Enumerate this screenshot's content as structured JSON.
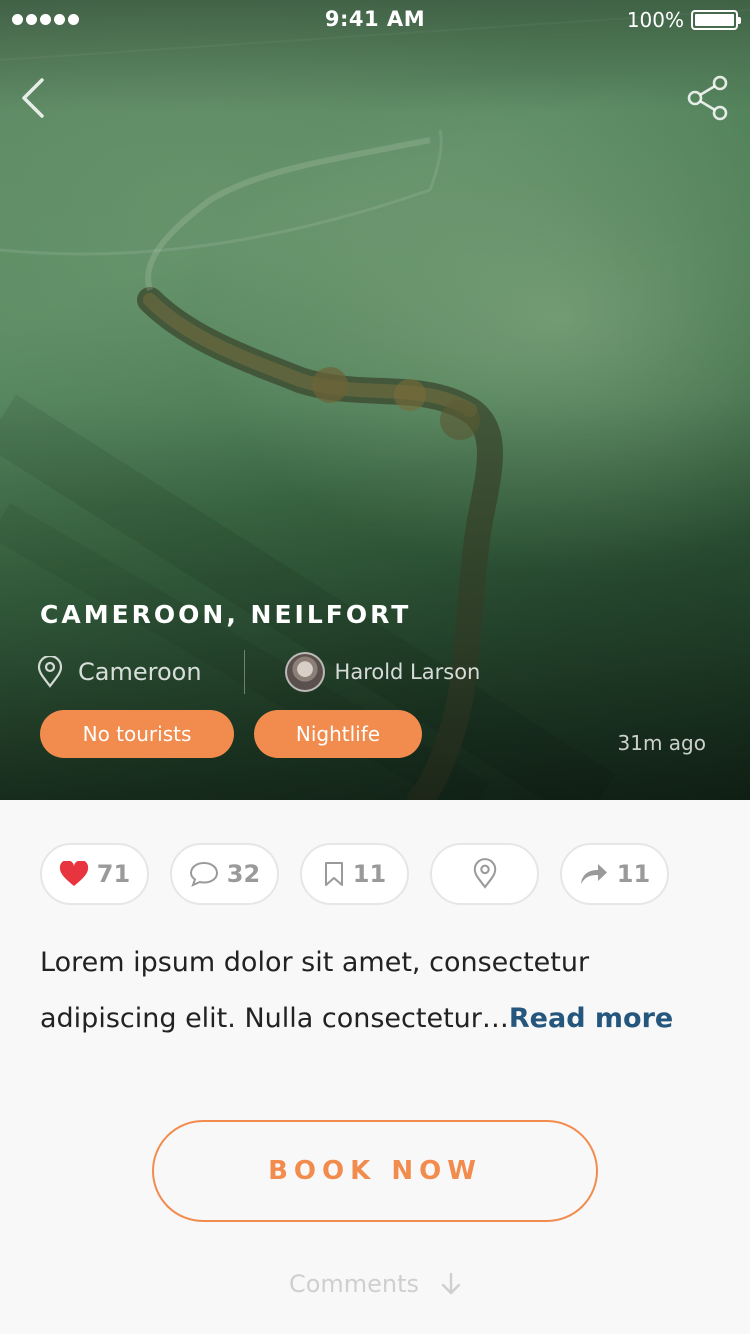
{
  "status_bar": {
    "time": "9:41 AM",
    "battery": "100%"
  },
  "hero": {
    "title": "CAMEROON, NEILFORT",
    "location": "Cameroon",
    "author": "Harold Larson",
    "tags": [
      "No tourists",
      "Nightlife"
    ],
    "time_ago": "31m ago"
  },
  "stats": {
    "likes": "71",
    "comments": "32",
    "bookmarks": "11",
    "shares": "11"
  },
  "description": {
    "text": "Lorem ipsum dolor sit amet, consectetur adipiscing elit. Nulla consectetur…",
    "read_more": "Read more"
  },
  "book_button": "BOOK NOW",
  "comments_label": "Comments",
  "colors": {
    "accent": "#f28c4e",
    "link": "#25567e",
    "heart": "#e8343f"
  }
}
